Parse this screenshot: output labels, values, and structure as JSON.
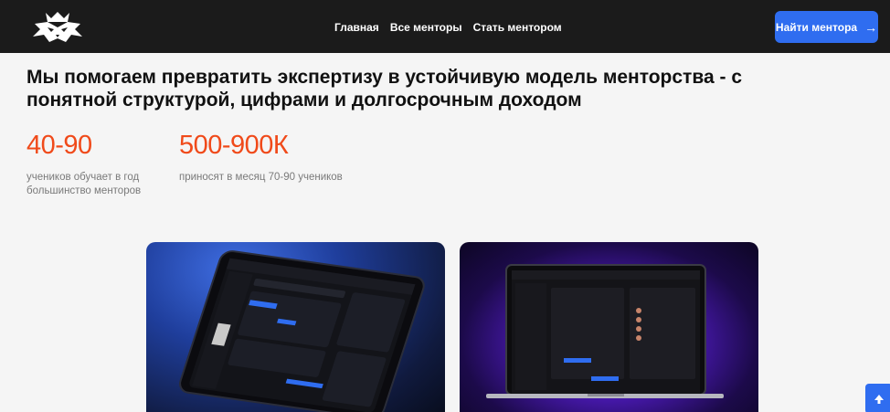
{
  "header": {
    "logo_icon": "tiger-head-logo-icon",
    "nav": [
      "Главная",
      "Все менторы",
      "Стать ментором"
    ],
    "cta_label": "Найти ментора",
    "cta_icon": "arrow-right-icon"
  },
  "hero": {
    "headline": "Мы помогаем превратить экспертизу в устойчивую модель менторства - с понятной структурой, цифрами и долгосрочным доходом"
  },
  "stats": [
    {
      "value": "40-90",
      "description_line1": "учеников обучает в год",
      "description_line2": "большинство менторов"
    },
    {
      "value": "500-900К",
      "description_line1": "приносят в месяц 70-90 учеников",
      "description_line2": ""
    }
  ],
  "cards": {
    "left_image": "tablet-dashboard-mockup",
    "right_image": "laptop-profile-mockup"
  },
  "scroll_top_icon": "arrow-up-icon",
  "colors": {
    "accent": "#f04a1a",
    "brand_blue": "#2f6df0",
    "header_bg": "#1b1b1b"
  }
}
